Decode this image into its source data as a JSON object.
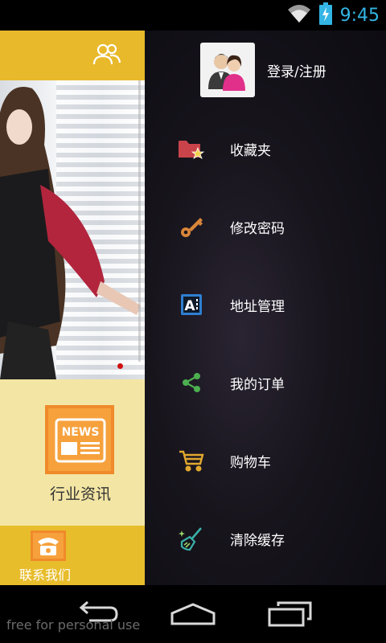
{
  "status_bar": {
    "time": "9:45",
    "icons": [
      "wifi-icon",
      "battery-charging-icon"
    ],
    "time_color": "#33b5e5"
  },
  "left_panel": {
    "accent": "#e8b92a",
    "news_label": "行业资讯",
    "news_badge": "NEWS",
    "contact_label": "联系我们"
  },
  "drawer": {
    "login_label": "登录/注册",
    "items": [
      {
        "label": "收藏夹",
        "icon": "folder-star-icon",
        "color": "#d9534f"
      },
      {
        "label": "修改密码",
        "icon": "key-icon",
        "color": "#d9863a"
      },
      {
        "label": "地址管理",
        "icon": "address-book-icon",
        "color": "#3a8ad9"
      },
      {
        "label": "我的订单",
        "icon": "share-icon",
        "color": "#4caf50"
      },
      {
        "label": "购物车",
        "icon": "cart-icon",
        "color": "#e0a82e"
      },
      {
        "label": "清除缓存",
        "icon": "broom-icon",
        "color": "#3ab0a8"
      }
    ]
  },
  "nav_bar": {
    "buttons": [
      "back-icon",
      "home-icon",
      "recents-icon"
    ]
  },
  "watermark": "free for personal use"
}
